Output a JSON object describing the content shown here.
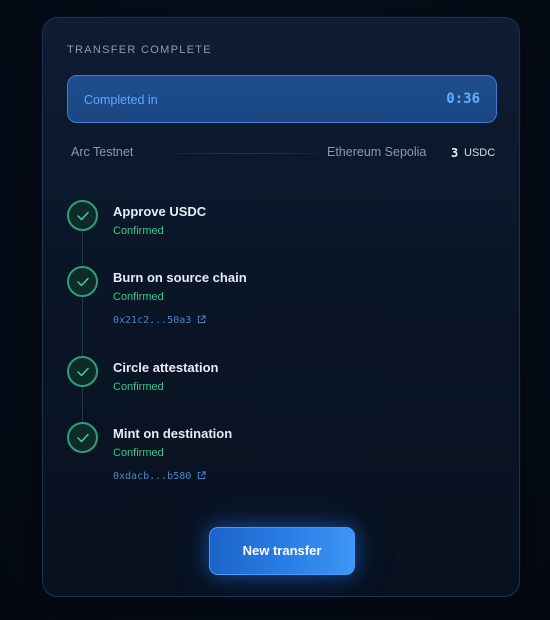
{
  "card": {
    "title": "TRANSFER COMPLETE"
  },
  "completed": {
    "label": "Completed in",
    "time": "0:36"
  },
  "route": {
    "source": "Arc Testnet",
    "destination": "Ethereum Sepolia",
    "amount": "3",
    "token": "USDC"
  },
  "steps": [
    {
      "title": "Approve USDC",
      "status": "Confirmed"
    },
    {
      "title": "Burn on source chain",
      "status": "Confirmed",
      "tx": "0x21c2...50a3"
    },
    {
      "title": "Circle attestation",
      "status": "Confirmed"
    },
    {
      "title": "Mint on destination",
      "status": "Confirmed",
      "tx": "0xdacb...b580"
    }
  ],
  "actions": {
    "new_transfer_label": "New transfer"
  },
  "colors": {
    "accent": "#2a7fe6",
    "success": "#35c98a",
    "link": "#4f86c4"
  },
  "icons": {
    "step_check": "check-icon",
    "tx_link": "external-link-icon"
  }
}
